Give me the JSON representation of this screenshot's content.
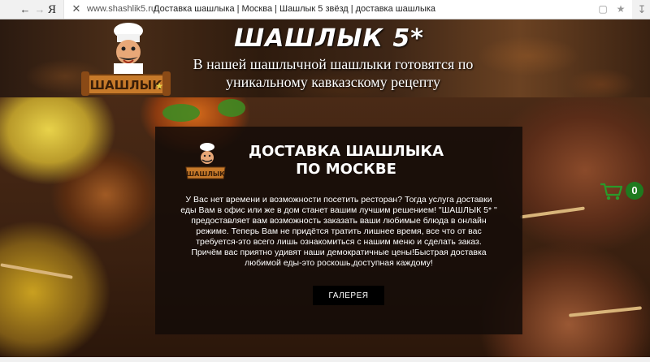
{
  "browser": {
    "back_icon": "back-arrow-icon",
    "forward_icon": "forward-arrow-icon",
    "logo_letter": "Я",
    "close_symbol": "✕",
    "domain": "www.shashlik5.ru",
    "page_title": "Доставка шашлыка | Москва | Шашлык 5 звёзд | доставка шашлыка"
  },
  "header": {
    "title": "ШАШЛЫК 5*",
    "subtitle": "В нашей шашлычной шашлыки готовятся по уникальному кавказскому рецепту",
    "logo_text": "ШАШЛЫК"
  },
  "content": {
    "title": "ДОСТАВКА ШАШЛЫКА ПО МОСКВЕ",
    "text": "У Вас нет времени и возможности посетить ресторан? Тогда услуга доставки еды Вам в офис или же в дом станет вашим лучшим решением! \"ШАШЛЫК 5* \" предоставляет вам возможность заказать ваши любимые блюда в онлайн режиме. Теперь Вам не придётся тратить лишнее время, все что от вас требуется-это всего лишь ознакомиться с нашим меню и сделать заказ. Причём вас приятно удивят наши демократичные цены!Быстрая доставка любимой еды-это роскошь,доступная каждому!",
    "gallery_button": "ГАЛЕРЕЯ"
  },
  "cart": {
    "count": "0",
    "icon": "cart-icon"
  },
  "colors": {
    "cart_green": "#1f7a1f",
    "box_bg": "#140c08",
    "header_brown": "#4a2d18"
  }
}
